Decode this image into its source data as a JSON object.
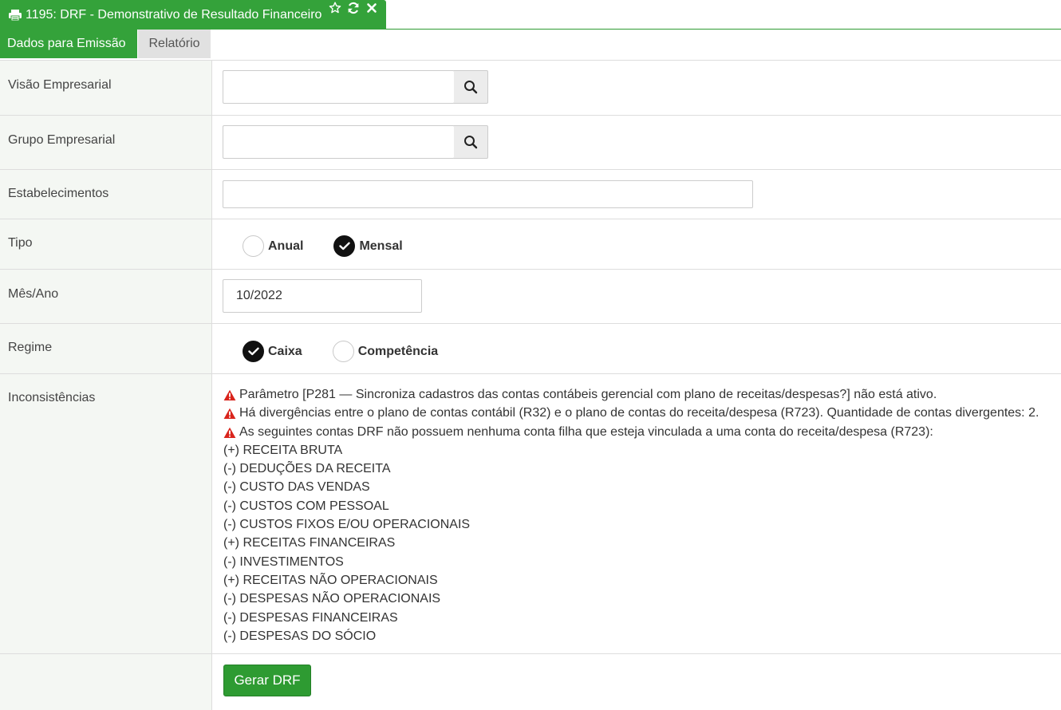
{
  "window": {
    "title": "1195: DRF - Demonstrativo de Resultado Financeiro",
    "title_icon": "print-icon",
    "actions": [
      "star-icon",
      "refresh-icon",
      "close-icon"
    ],
    "accent_color": "#34a23a"
  },
  "tabs": [
    {
      "label": "Dados para Emissão",
      "active": true
    },
    {
      "label": "Relatório",
      "active": false
    }
  ],
  "form": {
    "visao": {
      "label": "Visão Empresarial",
      "value": ""
    },
    "grupo": {
      "label": "Grupo Empresarial",
      "value": ""
    },
    "estabelecimentos": {
      "label": "Estabelecimentos",
      "value": ""
    },
    "tipo": {
      "label": "Tipo",
      "options": [
        {
          "label": "Anual",
          "checked": false
        },
        {
          "label": "Mensal",
          "checked": true
        }
      ]
    },
    "mes_ano": {
      "label": "Mês/Ano",
      "value": "10/2022"
    },
    "regime": {
      "label": "Regime",
      "options": [
        {
          "label": "Caixa",
          "checked": true
        },
        {
          "label": "Competência",
          "checked": false
        }
      ]
    },
    "inconsistencias": {
      "label": "Inconsistências",
      "warnings": [
        "Parâmetro [P281 — Sincroniza cadastros das contas contábeis gerencial com plano de receitas/despesas?] não está ativo.",
        "Há divergências entre o plano de contas contábil (R32) e o plano de contas do receita/despesa (R723). Quantidade de contas divergentes: 2.",
        "As seguintes contas DRF não possuem nenhuma conta filha que esteja vinculada a uma conta do receita/despesa (R723):"
      ],
      "accounts": [
        "(+) RECEITA BRUTA",
        "(-) DEDUÇÕES DA RECEITA",
        "(-) CUSTO DAS VENDAS",
        "(-) CUSTOS COM PESSOAL",
        "(-) CUSTOS FIXOS E/OU OPERACIONAIS",
        "(+) RECEITAS FINANCEIRAS",
        "(-) INVESTIMENTOS",
        "(+) RECEITAS NÃO OPERACIONAIS",
        "(-) DESPESAS NÃO OPERACIONAIS",
        "(-) DESPESAS FINANCEIRAS",
        "(-) DESPESAS DO SÓCIO"
      ]
    },
    "submit_label": "Gerar DRF"
  }
}
